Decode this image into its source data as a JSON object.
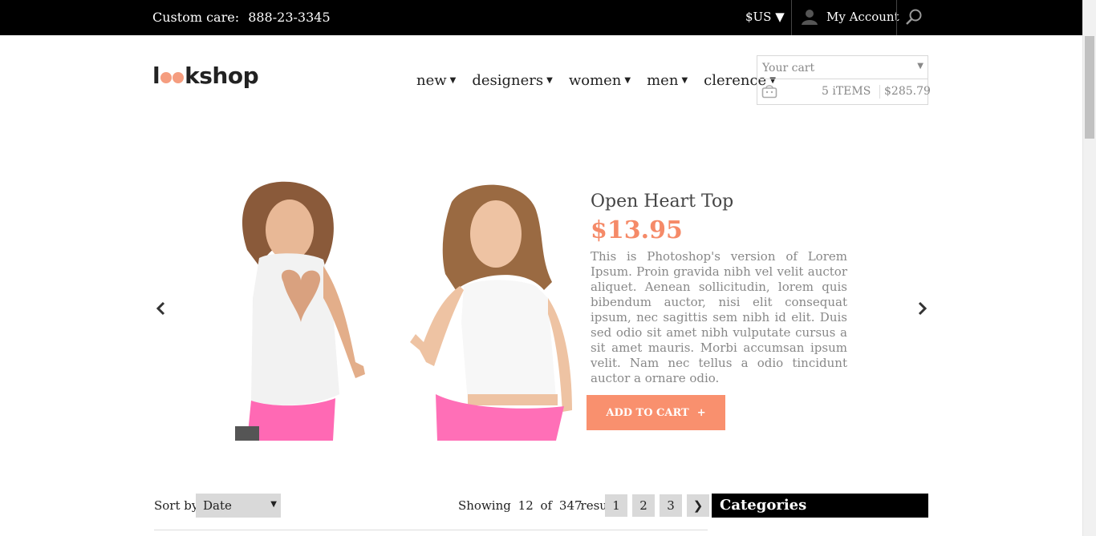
{
  "topbar": {
    "care_label": "Custom care:",
    "care_phone": "888-23-3345",
    "currency": "$US ▼",
    "account_label": "My Account"
  },
  "header": {
    "logo_l": "l",
    "logo_rest": "kshop",
    "nav": [
      "new",
      "designers",
      "women",
      "men",
      "clerence"
    ],
    "cart": {
      "placeholder": "Your cart",
      "items": "5 iTEMS",
      "total": "$285.79"
    }
  },
  "hero": {
    "title": "Open Heart Top",
    "price": "$13.95",
    "description": "This is Photoshop's version of Lorem Ipsum. Proin gravida nibh vel velit auctor aliquet. Aenean sollicitudin, lorem quis bibendum auctor, nisi elit consequat ipsum, nec sagittis sem nibh id elit. Duis sed odio sit amet nibh vulputate cursus a sit amet mauris. Morbi accumsan ipsum velit. Nam nec tellus a odio tincidunt auctor a ornare odio.",
    "add_to_cart": "ADD TO CART",
    "add_plus": "+"
  },
  "listing": {
    "sort_label": "Sort by",
    "sort_value": "Date",
    "showing_prefix": "Showing",
    "showing_count": "12",
    "showing_of": "of",
    "showing_total": "347",
    "showing_suffix": "results",
    "pages": [
      "1",
      "2",
      "3"
    ],
    "next": "❯"
  },
  "sidebar": {
    "categories_title": "Categories"
  },
  "colors": {
    "accent": "#f9906e",
    "price": "#f58a68",
    "topbar": "#000000"
  }
}
